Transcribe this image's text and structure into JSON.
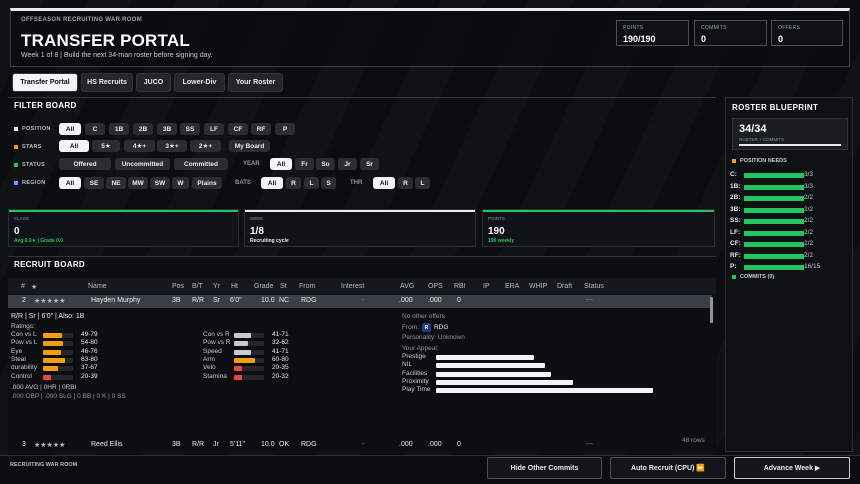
{
  "header": {
    "eyebrow": "OFFSEASON RECRUITING WAR ROOM",
    "title": "TRANSFER PORTAL",
    "subtitle": "Week 1 of 8 | Build the next 34-man roster before signing day.",
    "stats": [
      {
        "label": "POINTS",
        "value": "190/190"
      },
      {
        "label": "COMMITS",
        "value": "0"
      },
      {
        "label": "OFFERS",
        "value": "0"
      }
    ]
  },
  "tabs": [
    "Transfer Portal",
    "HS Recruits",
    "JUCO",
    "Lower-Div",
    "Your Roster"
  ],
  "filter": {
    "title": "FILTER BOARD",
    "position": {
      "label": "POSITION",
      "options": [
        "All",
        "C",
        "1B",
        "2B",
        "3B",
        "SS",
        "LF",
        "CF",
        "RF",
        "P"
      ]
    },
    "stars": {
      "label": "STARS",
      "options": [
        "All",
        "5★",
        "4★+",
        "3★+",
        "2★+",
        "My Board"
      ]
    },
    "status": {
      "label": "STATUS",
      "options": [
        "Offered",
        "Uncommitted",
        "Committed"
      ]
    },
    "year": {
      "label": "YEAR",
      "options": [
        "All",
        "Fr",
        "So",
        "Jr",
        "Sr"
      ]
    },
    "region": {
      "label": "REGION",
      "options": [
        "All",
        "SE",
        "NE",
        "MW",
        "SW",
        "W",
        "Plains"
      ]
    },
    "bats": {
      "label": "BATS",
      "options": [
        "All",
        "R",
        "L",
        "S"
      ]
    },
    "thr": {
      "label": "THR",
      "options": [
        "All",
        "R",
        "L"
      ]
    },
    "colors": {
      "position": "#e8ecef",
      "stars": "#f59e0b",
      "status": "#22c55e",
      "region": "#60a5fa"
    }
  },
  "kpis": [
    {
      "label": "CLASS",
      "value": "0",
      "sub": "Avg 0.0★ | Grade 0.0",
      "color": "#22c55e"
    },
    {
      "label": "WEEK",
      "value": "1/8",
      "sub": "Recruiting cycle",
      "color": "#e8ecef"
    },
    {
      "label": "POINTS",
      "value": "190",
      "sub": "190 weekly",
      "color": "#22c55e"
    }
  ],
  "board": {
    "title": "RECRUIT BOARD",
    "columns": [
      "#",
      "★",
      "Name",
      "Pos",
      "B/T",
      "Yr",
      "Ht",
      "Grade",
      "St",
      "From",
      "Interest",
      "AVG",
      "OPS",
      "RBI",
      "IP",
      "ERA",
      "WHIP",
      "Draft",
      "Status"
    ],
    "row_count": "48 rows",
    "rows": [
      {
        "num": "2",
        "stars": "★★★★★",
        "name": "Hayden Murphy",
        "pos": "3B",
        "bt": "R/R",
        "yr": "Sr",
        "ht": "6'0\"",
        "grade": "10.0",
        "st": "NC",
        "from": "RDG",
        "interest": "-",
        "avg": ".000",
        "ops": ".000",
        "rbi": "0",
        "status": "---"
      },
      {
        "num": "3",
        "stars": "★★★★★",
        "name": "Reed Ellis",
        "pos": "3B",
        "bt": "R/R",
        "yr": "Jr",
        "ht": "5'11\"",
        "grade": "10.0",
        "st": "OK",
        "from": "RDG",
        "interest": "-",
        "avg": ".000",
        "ops": ".000",
        "rbi": "0",
        "status": "---"
      }
    ],
    "detail": {
      "bio": "R/R  |  Sr  |  6'0\"  |  Also: 1B",
      "ratings_label": "Ratings:",
      "ratings_left": [
        {
          "label": "Con vs L",
          "value": "49-79",
          "level": 0.62,
          "color": "#f59e0b"
        },
        {
          "label": "Pow vs L",
          "value": "54-80",
          "level": 0.67,
          "color": "#f59e0b"
        },
        {
          "label": "Eye",
          "value": "46-76",
          "level": 0.6,
          "color": "#f59e0b"
        },
        {
          "label": "Steal",
          "value": "63-80",
          "level": 0.72,
          "color": "#f59e0b"
        },
        {
          "label": "durability",
          "value": "37-67",
          "level": 0.5,
          "color": "#f59e0b"
        },
        {
          "label": "Control",
          "value": "20-39",
          "level": 0.28,
          "color": "#ef4444"
        }
      ],
      "ratings_right": [
        {
          "label": "Con vs R",
          "value": "41-71",
          "level": 0.55,
          "color": "#c5cbd0"
        },
        {
          "label": "Pow vs R",
          "value": "32-62",
          "level": 0.45,
          "color": "#c5cbd0"
        },
        {
          "label": "Speed",
          "value": "41-71",
          "level": 0.55,
          "color": "#c5cbd0"
        },
        {
          "label": "Arm",
          "value": "60-80",
          "level": 0.7,
          "color": "#f59e0b"
        },
        {
          "label": "Velo",
          "value": "20-35",
          "level": 0.27,
          "color": "#ef4444"
        },
        {
          "label": "Stamina",
          "value": "20-32",
          "level": 0.26,
          "color": "#ef4444"
        }
      ],
      "stat_line1": ".000 AVG | 0HR | 0RBI",
      "stat_line2": ".000 OBP | .000 SLG | 0 BB | 0 K | 0 SS",
      "offers": "No other offers",
      "from_label": "From:",
      "from_badge": "R",
      "from_value": "RDG",
      "personality": "Personality: Unknown",
      "appeal_label": "Your Appeal:",
      "appeal": [
        {
          "label": "Prestige",
          "level": 0.45
        },
        {
          "label": "NIL",
          "level": 0.5
        },
        {
          "label": "Facilities",
          "level": 0.53
        },
        {
          "label": "Proximity",
          "level": 0.63
        },
        {
          "label": "Play Time",
          "level": 1.0
        }
      ]
    }
  },
  "roster": {
    "title": "ROSTER BLUEPRINT",
    "count": "34/34",
    "count_label": "ROSTER + COMMITS",
    "needs_label": "POSITION NEEDS",
    "needs": [
      {
        "pos": "C:",
        "value": "3/3",
        "level": 1.0
      },
      {
        "pos": "1B:",
        "value": "3/3",
        "level": 1.0
      },
      {
        "pos": "2B:",
        "value": "2/2",
        "level": 1.0
      },
      {
        "pos": "3B:",
        "value": "2/2",
        "level": 1.0
      },
      {
        "pos": "SS:",
        "value": "2/2",
        "level": 1.0
      },
      {
        "pos": "LF:",
        "value": "2/2",
        "level": 1.0
      },
      {
        "pos": "CF:",
        "value": "2/2",
        "level": 1.0
      },
      {
        "pos": "RF:",
        "value": "2/2",
        "level": 1.0
      },
      {
        "pos": "P:",
        "value": "16/15",
        "level": 1.0
      }
    ],
    "commits_label": "COMMITS (0)"
  },
  "footer": {
    "label": "RECRUITING WAR ROOM",
    "hide_commits": "Hide Other Commits",
    "auto_recruit": "Auto Recruit (CPU) ⏩",
    "advance_week": "Advance Week ▶"
  }
}
